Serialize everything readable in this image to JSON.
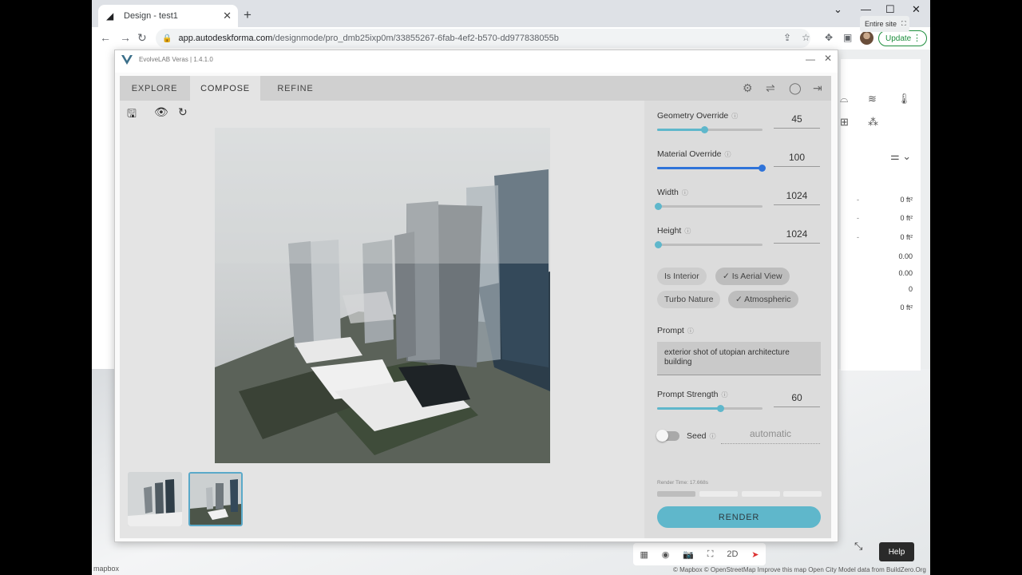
{
  "browser": {
    "tab_title": "Design - test1",
    "url_host": "app.autodeskforma.com",
    "url_path": "/designmode/pro_dmb25ixp0m/33855267-6fab-4ef2-b570-dd977838055b",
    "update_label": "Update"
  },
  "forma": {
    "scope_button": "Entire site",
    "metrics": [
      "0 ft²",
      "0 ft²",
      "0 ft²",
      "0.00",
      "0.00",
      "0",
      "0 ft²"
    ],
    "map_tools_2d": "2D",
    "help_label": "Help",
    "attribution": "© Mapbox © OpenStreetMap Improve this map Open City Model data from BuildZero.Org",
    "mapbox_label": "mapbox"
  },
  "veras": {
    "title": "EvolveLAB Veras | 1.4.1.0",
    "tabs": [
      "EXPLORE",
      "COMPOSE",
      "REFINE"
    ],
    "active_tab": "COMPOSE",
    "params": {
      "geometry_override": {
        "label": "Geometry Override",
        "value": "45",
        "fraction": 0.45
      },
      "material_override": {
        "label": "Material Override",
        "value": "100",
        "fraction": 1.0
      },
      "width": {
        "label": "Width",
        "value": "1024",
        "fraction": 0.0
      },
      "height": {
        "label": "Height",
        "value": "1024",
        "fraction": 0.0
      },
      "prompt_strength": {
        "label": "Prompt Strength",
        "value": "60",
        "fraction": 0.6
      }
    },
    "chips": {
      "is_interior": "Is Interior",
      "is_aerial_view": "✓ Is Aerial View",
      "turbo_nature": "Turbo Nature",
      "atmospheric": "✓ Atmospheric"
    },
    "prompt_label": "Prompt",
    "prompt_text": "exterior shot of utopian architecture building",
    "seed_label": "Seed",
    "seed_value": "automatic",
    "render_time": "Render Time: 17.668s",
    "render_button": "RENDER",
    "accent_color": "#5fb7cb"
  }
}
